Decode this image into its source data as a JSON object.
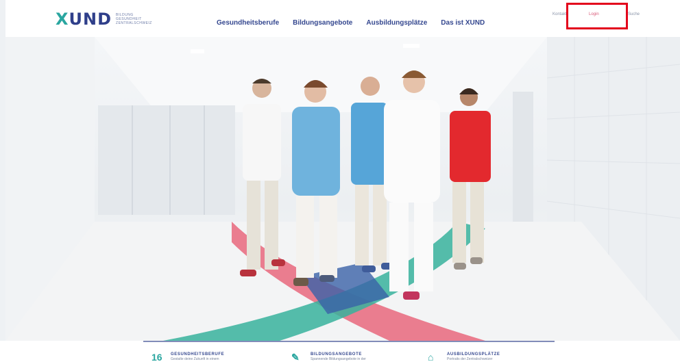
{
  "logo": {
    "wordmark": "XUND",
    "subline": [
      "BILDUNG",
      "GESUNDHEIT",
      "ZENTRALSCHWEIZ"
    ]
  },
  "nav": {
    "items": [
      "Gesundheitsberufe",
      "Bildungsangebote",
      "Ausbildungsplätze",
      "Das ist XUND"
    ]
  },
  "utility": {
    "kontakt": "Kontakt",
    "login": "Login",
    "suche": "Suche"
  },
  "teaser": {
    "items": [
      {
        "icon": "number-16-icon",
        "icon_text": "16",
        "title": "GESUNDHEITSBERUFE",
        "desc": "Gestalte deine Zukunft in einem"
      },
      {
        "icon": "pencil-icon",
        "icon_text": "✎",
        "title": "BILDUNGSANGEBOTE",
        "desc": "Spannende Bildungsangebote in der"
      },
      {
        "icon": "house-icon",
        "icon_text": "⌂",
        "title": "AUSBILDUNGSPLÄTZE",
        "desc": "Portraits der Zentralschweizer"
      }
    ]
  },
  "colors": {
    "brand_teal": "#2aa6a0",
    "brand_blue": "#2f3f8a",
    "accent_pink": "#e8677c",
    "highlight_red": "#e3001b"
  }
}
